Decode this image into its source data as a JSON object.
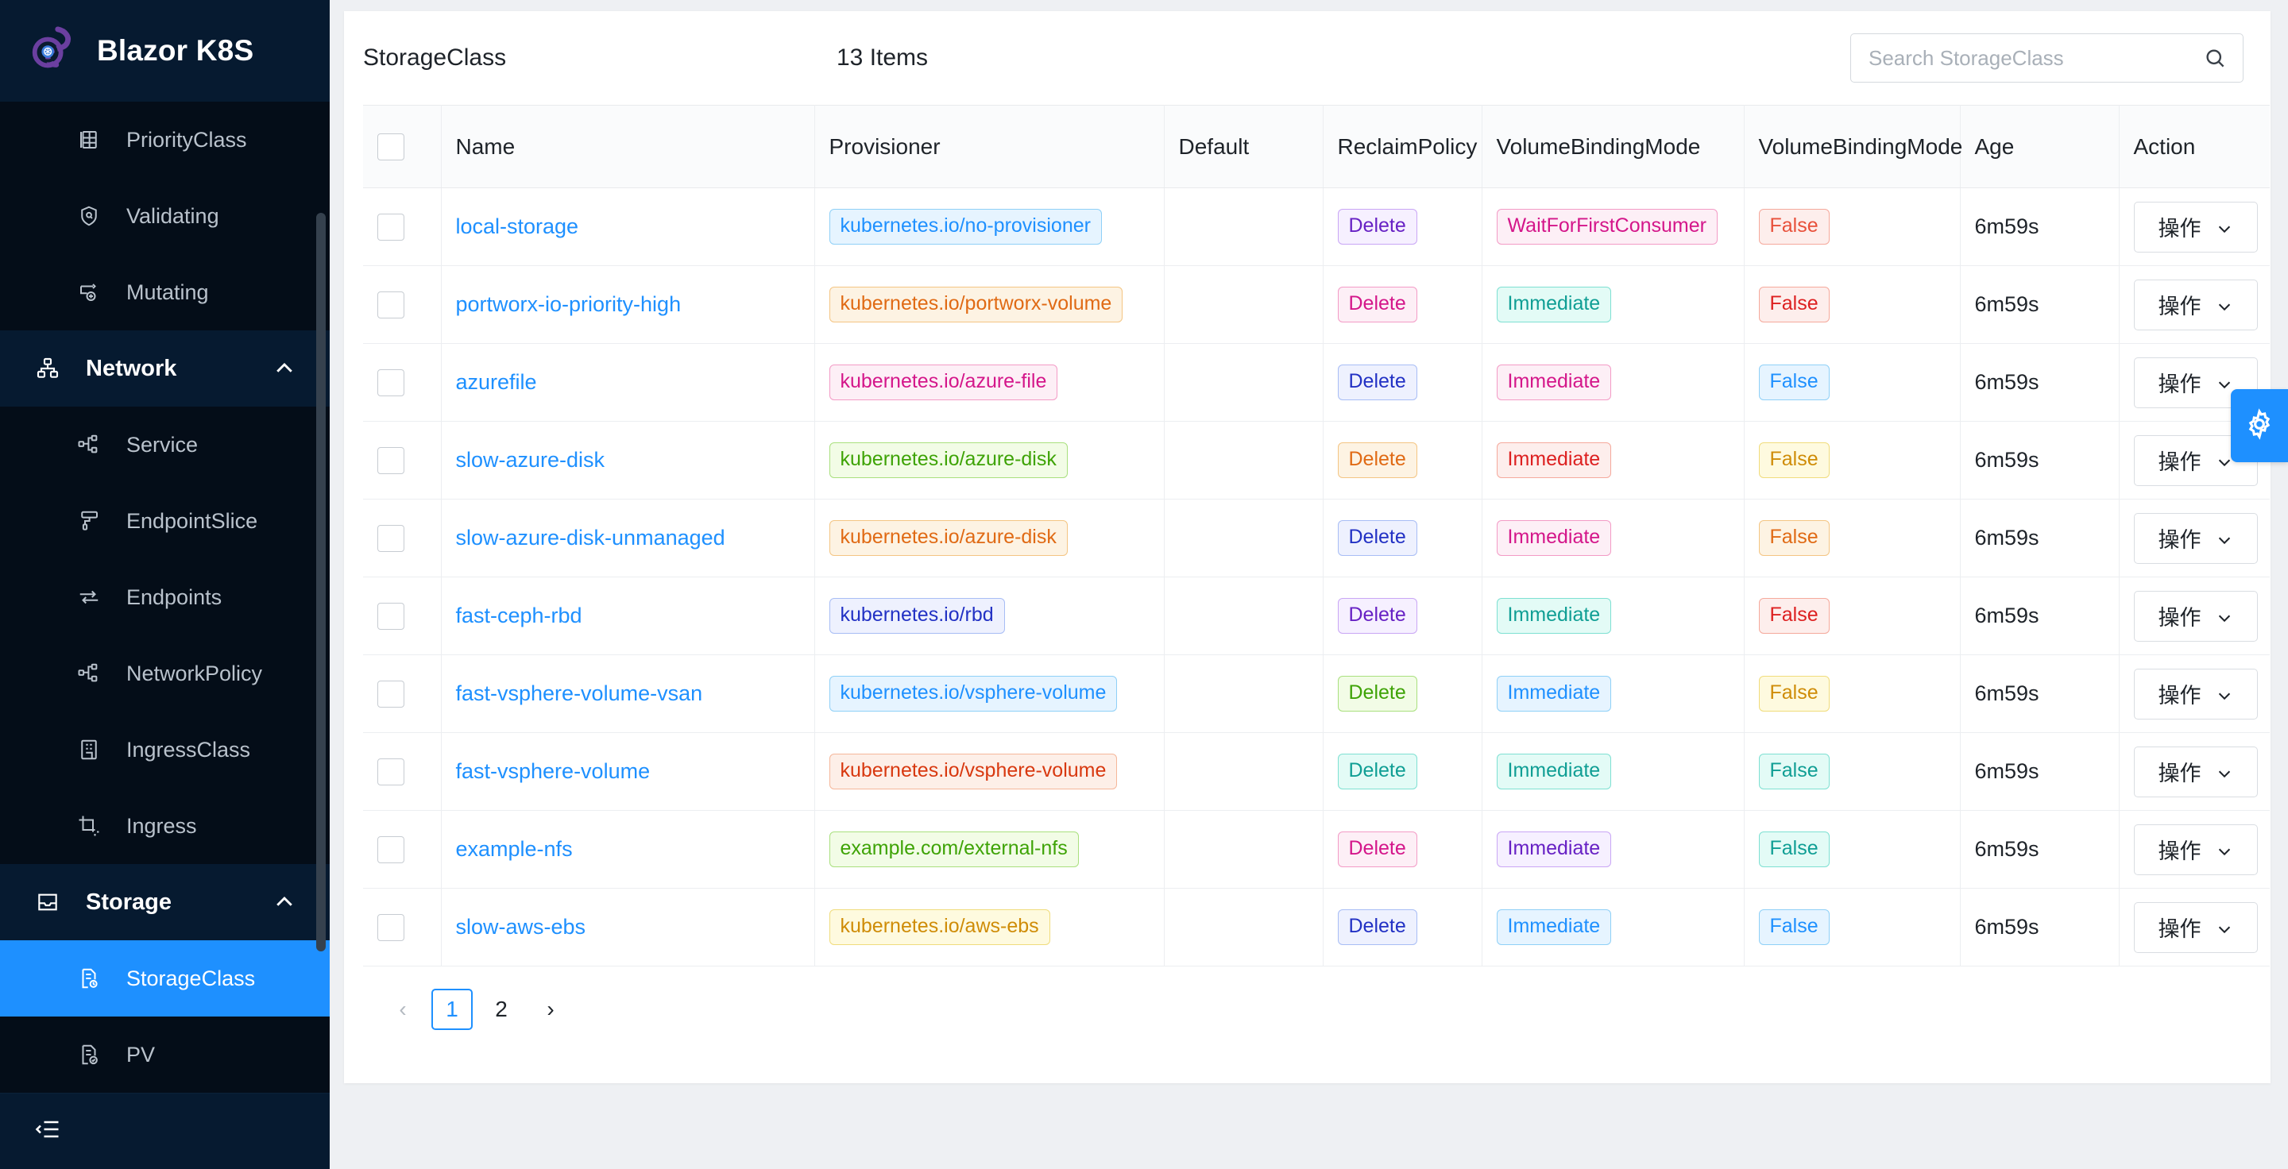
{
  "brand": {
    "title": "Blazor K8S",
    "logo_icon": "blazor-logo-icon"
  },
  "sidebar": {
    "items": [
      {
        "label": "PriorityClass",
        "icon": "table-icon",
        "type": "item",
        "active": false
      },
      {
        "label": "Validating",
        "icon": "shield-search-icon",
        "type": "item",
        "active": false
      },
      {
        "label": "Mutating",
        "icon": "flow-add-icon",
        "type": "item",
        "active": false
      },
      {
        "label": "Network",
        "icon": "sitemap-icon",
        "type": "group",
        "expanded": true
      },
      {
        "label": "Service",
        "icon": "nodes-icon",
        "type": "item",
        "active": false
      },
      {
        "label": "EndpointSlice",
        "icon": "roller-icon",
        "type": "item",
        "active": false
      },
      {
        "label": "Endpoints",
        "icon": "arrows-exchange-icon",
        "type": "item",
        "active": false
      },
      {
        "label": "NetworkPolicy",
        "icon": "nodes-icon",
        "type": "item",
        "active": false
      },
      {
        "label": "IngressClass",
        "icon": "building-icon",
        "type": "item",
        "active": false
      },
      {
        "label": "Ingress",
        "icon": "crop-icon",
        "type": "item",
        "active": false
      },
      {
        "label": "Storage",
        "icon": "inbox-icon",
        "type": "group",
        "expanded": true
      },
      {
        "label": "StorageClass",
        "icon": "file-settings-icon",
        "type": "item",
        "active": true
      },
      {
        "label": "PV",
        "icon": "file-check-icon",
        "type": "item",
        "active": false
      }
    ],
    "collapse_icon": "collapse-sidebar-icon"
  },
  "header": {
    "page_title": "StorageClass",
    "items_count": "13 Items"
  },
  "search": {
    "placeholder": "Search StorageClass",
    "value": "",
    "icon": "search-icon"
  },
  "table": {
    "columns": [
      "",
      "Name",
      "Provisioner",
      "Default",
      "ReclaimPolicy",
      "VolumeBindingMode",
      "VolumeBindingMode",
      "Age",
      "Action"
    ],
    "action_label": "操作",
    "rows": [
      {
        "name": "local-storage",
        "provisioner": "kubernetes.io/no-provisioner",
        "provisioner_color": {
          "fg": "#1e90ff",
          "bg": "#e6f4ff",
          "border": "#8fd0f7"
        },
        "default": "",
        "reclaim": "Delete",
        "reclaim_color": {
          "fg": "#6721c4",
          "bg": "#f6f0ff",
          "border": "#c9a6f5"
        },
        "vbm1": "WaitForFirstConsumer",
        "vbm1_color": {
          "fg": "#d4168a",
          "bg": "#fdeff6",
          "border": "#f39bc6"
        },
        "vbm2": "False",
        "vbm2_color": {
          "fg": "#e8503a",
          "bg": "#fdeeec",
          "border": "#f5a99c"
        },
        "age": "6m59s"
      },
      {
        "name": "portworx-io-priority-high",
        "provisioner": "kubernetes.io/portworx-volume",
        "provisioner_color": {
          "fg": "#e06a14",
          "bg": "#fdf3e3",
          "border": "#f4c583"
        },
        "default": "",
        "reclaim": "Delete",
        "reclaim_color": {
          "fg": "#d4168a",
          "bg": "#fdeff6",
          "border": "#f39bc6"
        },
        "vbm1": "Immediate",
        "vbm1_color": {
          "fg": "#0f9e94",
          "bg": "#e3fbf6",
          "border": "#7ee0d2"
        },
        "vbm2": "False",
        "vbm2_color": {
          "fg": "#dd2020",
          "bg": "#fdeeec",
          "border": "#f5a99c"
        },
        "age": "6m59s"
      },
      {
        "name": "azurefile",
        "provisioner": "kubernetes.io/azure-file",
        "provisioner_color": {
          "fg": "#d4168a",
          "bg": "#fdeff6",
          "border": "#f39bc6"
        },
        "default": "",
        "reclaim": "Delete",
        "reclaim_color": {
          "fg": "#2231c4",
          "bg": "#eef1fe",
          "border": "#a8bdf5"
        },
        "vbm1": "Immediate",
        "vbm1_color": {
          "fg": "#d4168a",
          "bg": "#fdeff6",
          "border": "#f39bc6"
        },
        "vbm2": "False",
        "vbm2_color": {
          "fg": "#1e90ff",
          "bg": "#e6f4ff",
          "border": "#8fd0f7"
        },
        "age": "6m59s"
      },
      {
        "name": "slow-azure-disk",
        "provisioner": "kubernetes.io/azure-disk",
        "provisioner_color": {
          "fg": "#3ea306",
          "bg": "#f2fce6",
          "border": "#a9e07e"
        },
        "default": "",
        "reclaim": "Delete",
        "reclaim_color": {
          "fg": "#e06a14",
          "bg": "#fdf3e3",
          "border": "#f4c583"
        },
        "vbm1": "Immediate",
        "vbm1_color": {
          "fg": "#dd2020",
          "bg": "#fdeeec",
          "border": "#f5a99c"
        },
        "vbm2": "False",
        "vbm2_color": {
          "fg": "#cf8c07",
          "bg": "#fefadf",
          "border": "#f0dc7c"
        },
        "age": "6m59s"
      },
      {
        "name": "slow-azure-disk-unmanaged",
        "provisioner": "kubernetes.io/azure-disk",
        "provisioner_color": {
          "fg": "#e06a14",
          "bg": "#fdf3e3",
          "border": "#f4c583"
        },
        "default": "",
        "reclaim": "Delete",
        "reclaim_color": {
          "fg": "#2231c4",
          "bg": "#eef1fe",
          "border": "#a8bdf5"
        },
        "vbm1": "Immediate",
        "vbm1_color": {
          "fg": "#d4168a",
          "bg": "#fdeff6",
          "border": "#f39bc6"
        },
        "vbm2": "False",
        "vbm2_color": {
          "fg": "#e06a14",
          "bg": "#fdf3e3",
          "border": "#f4c583"
        },
        "age": "6m59s"
      },
      {
        "name": "fast-ceph-rbd",
        "provisioner": "kubernetes.io/rbd",
        "provisioner_color": {
          "fg": "#2231c4",
          "bg": "#eef1fe",
          "border": "#a8bdf5"
        },
        "default": "",
        "reclaim": "Delete",
        "reclaim_color": {
          "fg": "#6721c4",
          "bg": "#f6f0ff",
          "border": "#c9a6f5"
        },
        "vbm1": "Immediate",
        "vbm1_color": {
          "fg": "#0f9e94",
          "bg": "#e3fbf6",
          "border": "#7ee0d2"
        },
        "vbm2": "False",
        "vbm2_color": {
          "fg": "#dd2020",
          "bg": "#fdeeec",
          "border": "#f5a99c"
        },
        "age": "6m59s"
      },
      {
        "name": "fast-vsphere-volume-vsan",
        "provisioner": "kubernetes.io/vsphere-volume",
        "provisioner_color": {
          "fg": "#1e90ff",
          "bg": "#e6f4ff",
          "border": "#8fd0f7"
        },
        "default": "",
        "reclaim": "Delete",
        "reclaim_color": {
          "fg": "#3ea306",
          "bg": "#f2fce6",
          "border": "#a9e07e"
        },
        "vbm1": "Immediate",
        "vbm1_color": {
          "fg": "#1e90ff",
          "bg": "#e6f4ff",
          "border": "#8fd0f7"
        },
        "vbm2": "False",
        "vbm2_color": {
          "fg": "#cf8c07",
          "bg": "#fefadf",
          "border": "#f0dc7c"
        },
        "age": "6m59s"
      },
      {
        "name": "fast-vsphere-volume",
        "provisioner": "kubernetes.io/vsphere-volume",
        "provisioner_color": {
          "fg": "#d8380f",
          "bg": "#fdefe8",
          "border": "#f5b79a"
        },
        "default": "",
        "reclaim": "Delete",
        "reclaim_color": {
          "fg": "#0f9e94",
          "bg": "#e3fbf6",
          "border": "#7ee0d2"
        },
        "vbm1": "Immediate",
        "vbm1_color": {
          "fg": "#0f9e94",
          "bg": "#e3fbf6",
          "border": "#7ee0d2"
        },
        "vbm2": "False",
        "vbm2_color": {
          "fg": "#0f9e94",
          "bg": "#e3fbf6",
          "border": "#7ee0d2"
        },
        "age": "6m59s"
      },
      {
        "name": "example-nfs",
        "provisioner": "example.com/external-nfs",
        "provisioner_color": {
          "fg": "#3ea306",
          "bg": "#f2fce6",
          "border": "#a9e07e"
        },
        "default": "",
        "reclaim": "Delete",
        "reclaim_color": {
          "fg": "#d4168a",
          "bg": "#fdeff6",
          "border": "#f39bc6"
        },
        "vbm1": "Immediate",
        "vbm1_color": {
          "fg": "#6721c4",
          "bg": "#f6f0ff",
          "border": "#c9a6f5"
        },
        "vbm2": "False",
        "vbm2_color": {
          "fg": "#0f9e94",
          "bg": "#e3fbf6",
          "border": "#7ee0d2"
        },
        "age": "6m59s"
      },
      {
        "name": "slow-aws-ebs",
        "provisioner": "kubernetes.io/aws-ebs",
        "provisioner_color": {
          "fg": "#cf8c07",
          "bg": "#fefadf",
          "border": "#f0dc7c"
        },
        "default": "",
        "reclaim": "Delete",
        "reclaim_color": {
          "fg": "#2231c4",
          "bg": "#eef1fe",
          "border": "#a8bdf5"
        },
        "vbm1": "Immediate",
        "vbm1_color": {
          "fg": "#1e90ff",
          "bg": "#e6f4ff",
          "border": "#8fd0f7"
        },
        "vbm2": "False",
        "vbm2_color": {
          "fg": "#1e90ff",
          "bg": "#e6f4ff",
          "border": "#8fd0f7"
        },
        "age": "6m59s"
      }
    ]
  },
  "pagination": {
    "prev": "‹",
    "next": "›",
    "pages": [
      "1",
      "2"
    ],
    "current": "1"
  },
  "fab": {
    "icon": "gear-icon",
    "color": "#1e90ff"
  }
}
